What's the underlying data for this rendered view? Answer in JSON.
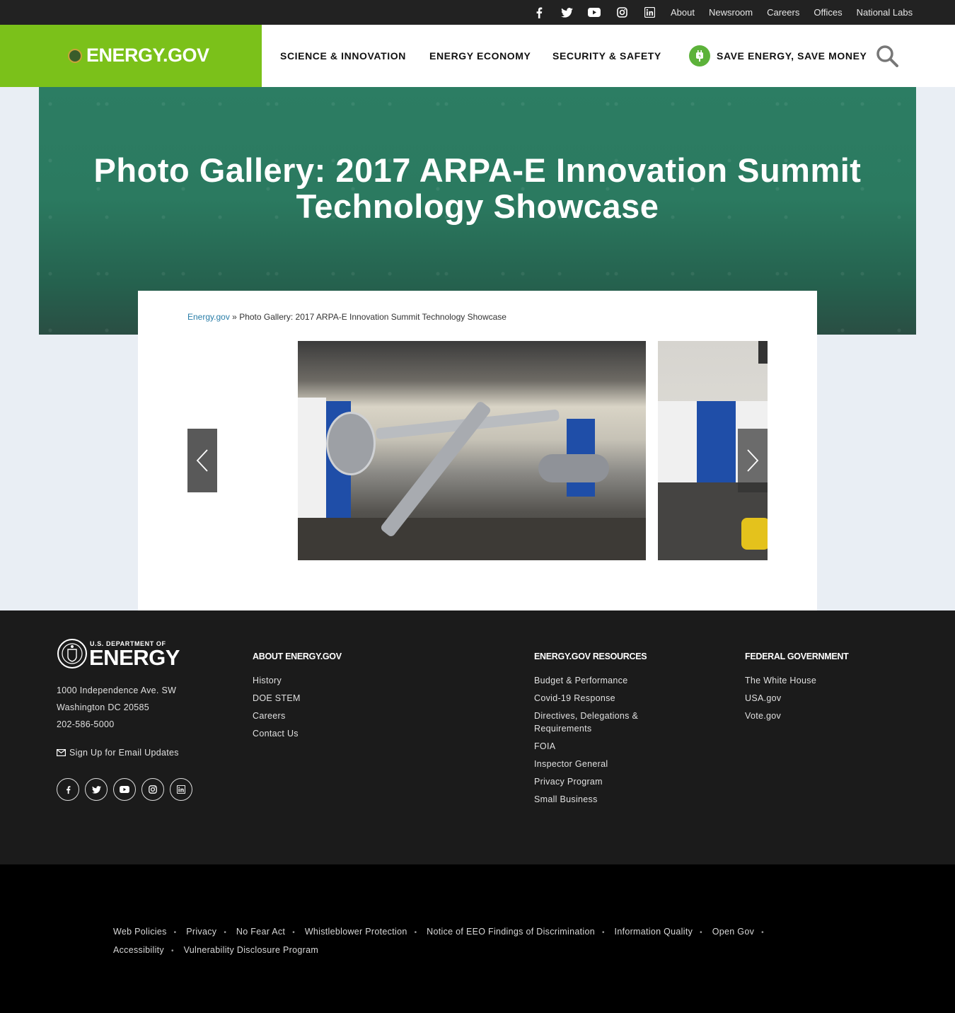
{
  "utility_bar": {
    "social_icons": [
      "facebook-icon",
      "twitter-icon",
      "youtube-icon",
      "instagram-icon",
      "linkedin-icon"
    ],
    "links": [
      "About",
      "Newsroom",
      "Careers",
      "Offices",
      "National Labs"
    ]
  },
  "header": {
    "logo_text": "ENERGY.GOV",
    "nav": [
      "SCIENCE & INNOVATION",
      "ENERGY ECONOMY",
      "SECURITY & SAFETY",
      "SAVE ENERGY, SAVE MONEY"
    ],
    "brand_color": "#7bc11a"
  },
  "hero": {
    "title": "Photo Gallery: 2017 ARPA-E Innovation Summit Technology Showcase"
  },
  "breadcrumb": {
    "home": "Energy.gov",
    "separator": "»",
    "current": "Photo Gallery: 2017 ARPA-E Innovation Summit Technology Showcase"
  },
  "gallery": {
    "prev_icon": "chevron-left-icon",
    "next_icon": "chevron-right-icon"
  },
  "footer": {
    "logo_small": "U.S. DEPARTMENT OF",
    "logo_big": "ENERGY",
    "address": [
      "1000 Independence Ave. SW",
      "Washington DC 20585",
      "202-586-5000"
    ],
    "email_signup": "Sign Up for Email Updates",
    "columns": [
      {
        "title": "ABOUT ENERGY.GOV",
        "links": [
          "History",
          "DOE STEM",
          "Careers",
          "Contact Us"
        ]
      },
      {
        "title": "ENERGY.GOV RESOURCES",
        "links": [
          "Budget & Performance",
          "Covid-19 Response",
          "Directives, Delegations & Requirements",
          "FOIA",
          "Inspector General",
          "Privacy Program",
          "Small Business"
        ]
      },
      {
        "title": "FEDERAL GOVERNMENT",
        "links": [
          "The White House",
          "USA.gov",
          "Vote.gov"
        ]
      }
    ]
  },
  "legal_links": [
    "Web Policies",
    "Privacy",
    "No Fear Act",
    "Whistleblower Protection",
    "Notice of EEO Findings of Discrimination",
    "Information Quality",
    "Open Gov",
    "Accessibility",
    "Vulnerability Disclosure Program"
  ]
}
